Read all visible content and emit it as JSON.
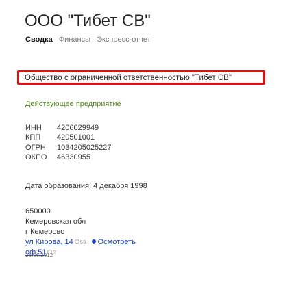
{
  "company": {
    "title": "ООО \"Тибет СВ\"",
    "full_name": "Общество с ограниченной ответственностью \"Тибет СВ\"",
    "status": "Действующее предприятие",
    "founded": "Дата образования: 4 декабря 1998"
  },
  "tabs": [
    {
      "label": "Сводка",
      "active": true
    },
    {
      "label": "Финансы",
      "active": false
    },
    {
      "label": "Экспресс-отчет",
      "active": false
    }
  ],
  "codes": [
    {
      "label": "ИНН",
      "value": "4206029949"
    },
    {
      "label": "КПП",
      "value": "420501001"
    },
    {
      "label": "ОГРН",
      "value": "1034205025227"
    },
    {
      "label": "ОКПО",
      "value": "46330955"
    }
  ],
  "address": {
    "postal_code": "650000",
    "region": "Кемеровская обл",
    "city": "г Кемерово",
    "street": "ул Кирова, 14",
    "street_count": "59",
    "view_map": "Осмотреть",
    "office": "оф 51",
    "office_count": "2",
    "date": "28.06.2012"
  },
  "colors": {
    "highlight_border": "#e01010",
    "status": "#558822",
    "link": "#1a3dc1"
  }
}
